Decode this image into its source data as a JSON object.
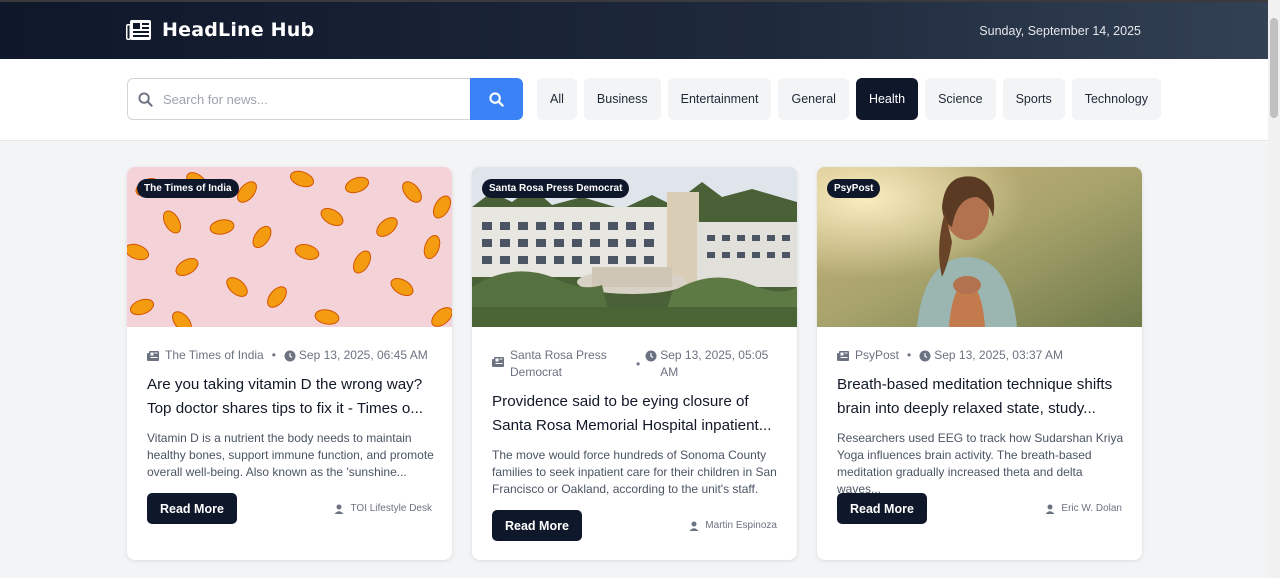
{
  "header": {
    "brand": "HeadLine Hub",
    "date": "Sunday, September 14, 2025",
    "logo_icon": "newspaper-icon"
  },
  "search": {
    "placeholder": "Search for news...",
    "value": "",
    "button_icon": "search-icon",
    "button_color": "#3b82f6"
  },
  "categories": {
    "items": [
      "All",
      "Business",
      "Entertainment",
      "General",
      "Health",
      "Science",
      "Sports",
      "Technology"
    ],
    "active": "Health",
    "active_color": "#0f172a"
  },
  "articles": [
    {
      "badge": "The Times of India",
      "source": "The Times of India",
      "time": "Sep 13, 2025, 06:45 AM",
      "title": "Are you taking vitamin D the wrong way? Top doctor shares tips to fix it - Times o...",
      "description": "Vitamin D is a nutrient the body needs to maintain healthy bones, support immune function, and promote overall well-being. Also known as the 'sunshine...",
      "button": "Read More",
      "author": "TOI Lifestyle Desk"
    },
    {
      "badge": "Santa Rosa Press Democrat",
      "source": "Santa Rosa Press Democrat",
      "time": "Sep 13, 2025, 05:05 AM",
      "title": "Providence said to be eying closure of Santa Rosa Memorial Hospital inpatient...",
      "description": "The move would force hundreds of Sonoma County families to seek inpatient care for their children in San Francisco or Oakland, according to the unit's staff.",
      "button": "Read More",
      "author": "Martin Espinoza"
    },
    {
      "badge": "PsyPost",
      "source": "PsyPost",
      "time": "Sep 13, 2025, 03:37 AM",
      "title": "Breath-based meditation technique shifts brain into deeply relaxed state, study...",
      "description": "Researchers used EEG to track how Sudarshan Kriya Yoga influences brain activity. The breath-based meditation gradually increased theta and delta waves...",
      "button": "Read More",
      "author": "Eric W. Dolan"
    }
  ]
}
